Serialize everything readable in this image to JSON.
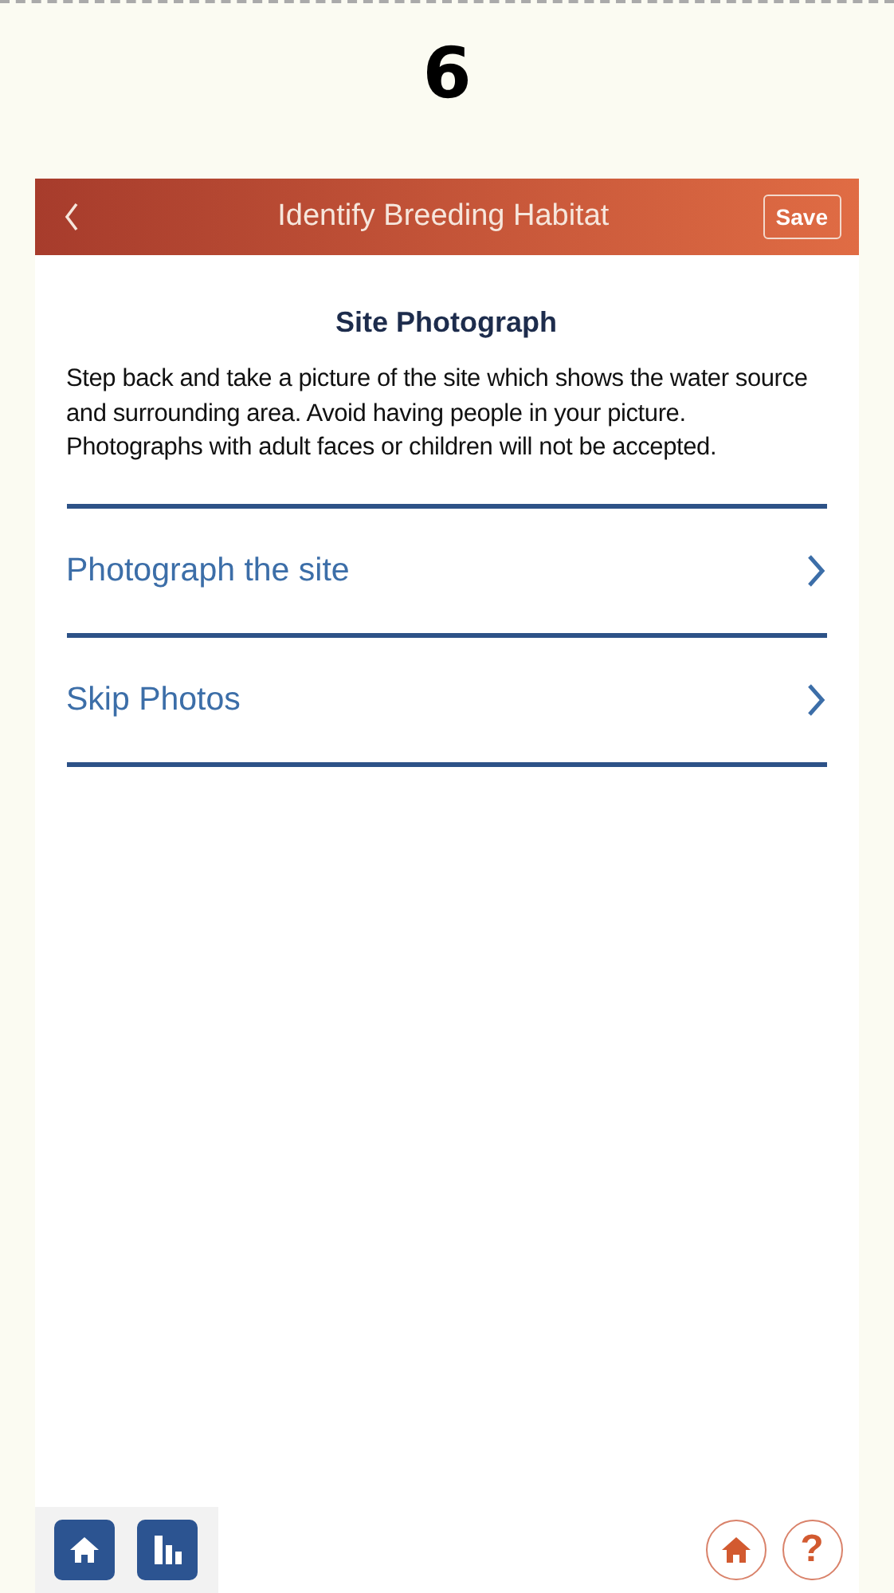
{
  "step_number": "6",
  "header": {
    "title": "Identify Breeding Habitat",
    "save_button": "Save"
  },
  "section_title": "Site Photograph",
  "instructions": "Step back and take a picture of the site which shows the water source and surrounding area. Avoid having people in your picture. Photographs with adult faces or children will not be accepted.",
  "options": [
    {
      "label": "Photograph the site"
    },
    {
      "label": "Skip Photos"
    }
  ],
  "help_button": "?"
}
